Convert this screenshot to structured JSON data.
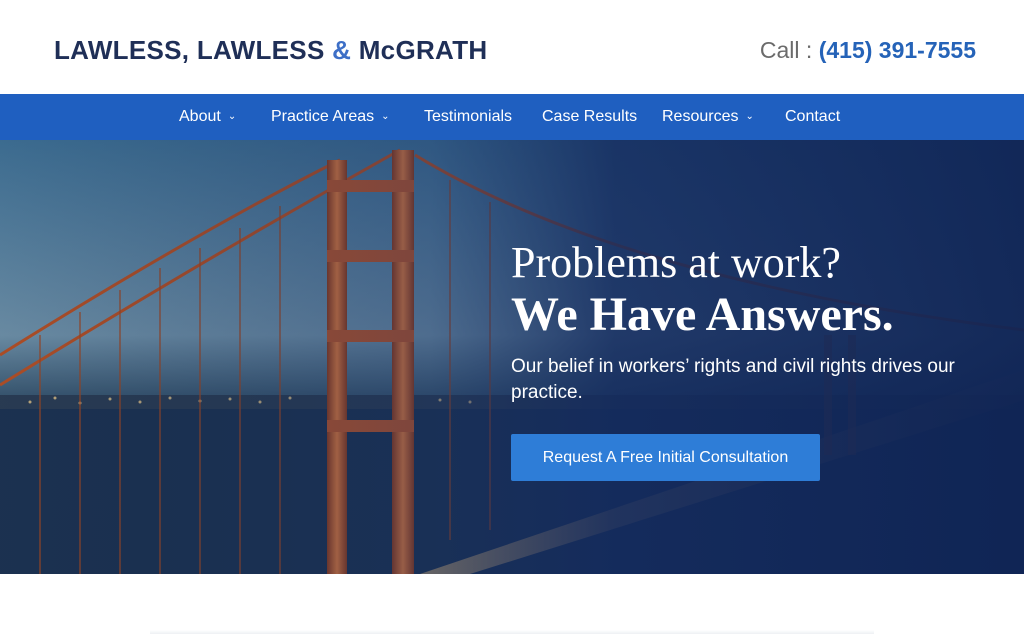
{
  "header": {
    "logo_part1": "LAWLESS, LAWLESS ",
    "logo_amp": "&",
    "logo_part2": " McGRATH",
    "call_label": "Call : ",
    "phone": "(415) 391-7555"
  },
  "nav": {
    "items": [
      {
        "label": "About",
        "dropdown": true
      },
      {
        "label": "Practice Areas",
        "dropdown": true
      },
      {
        "label": "Testimonials",
        "dropdown": false
      },
      {
        "label": "Case Results",
        "dropdown": false
      },
      {
        "label": "Resources",
        "dropdown": true
      },
      {
        "label": "Contact",
        "dropdown": false
      }
    ],
    "chevron": "chevron-down-icon"
  },
  "hero": {
    "headline_1": "Problems at work?",
    "headline_2": "We Have Answers.",
    "subtext": "Our belief in workers’ rights and civil rights drives our practice.",
    "cta_label": "Request A Free Initial Consultation",
    "background_image": "golden-gate-bridge-at-dusk"
  },
  "colors": {
    "logo_text": "#1f2f57",
    "logo_ampersand": "#3d6fc7",
    "phone": "#2563b8",
    "nav_bar": "#1f5fc0",
    "cta_button": "#2e7dd7",
    "hero_overlay": "#1b3a78",
    "bridge": "#c45a2a"
  }
}
